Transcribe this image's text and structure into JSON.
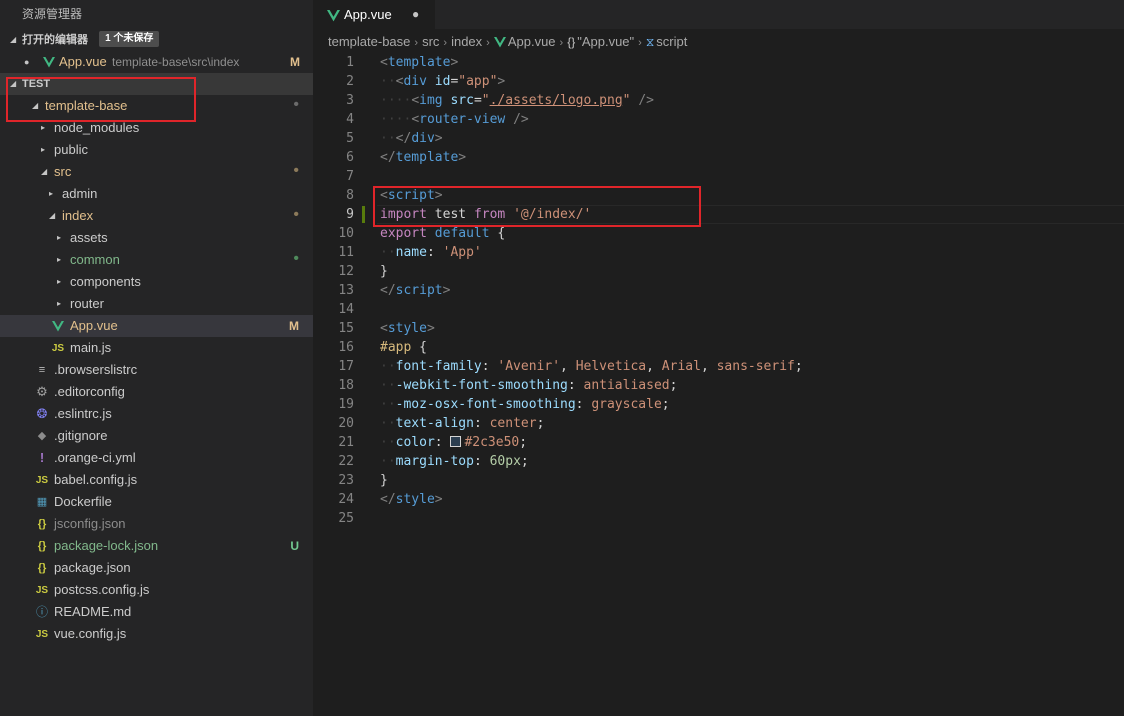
{
  "sidebar": {
    "title": "资源管理器",
    "open_editors": {
      "header": "打开的编辑器",
      "badge": "1 个未保存",
      "items": [
        {
          "name": "App.vue",
          "description": "template-base\\src\\index",
          "status": "M"
        }
      ]
    },
    "workspace": {
      "header": "TEST",
      "root": "template-base"
    },
    "tree": [
      {
        "name": "template-base",
        "kind": "folder",
        "expanded": true,
        "depth": 0,
        "status": "dot"
      },
      {
        "name": "node_modules",
        "kind": "folder",
        "expanded": false,
        "depth": 1,
        "status": ""
      },
      {
        "name": "public",
        "kind": "folder",
        "expanded": false,
        "depth": 1,
        "status": ""
      },
      {
        "name": "src",
        "kind": "folder",
        "expanded": true,
        "depth": 1,
        "status": "dot"
      },
      {
        "name": "admin",
        "kind": "folder",
        "expanded": false,
        "depth": 2,
        "status": ""
      },
      {
        "name": "index",
        "kind": "folder",
        "expanded": true,
        "depth": 2,
        "status": "dot"
      },
      {
        "name": "assets",
        "kind": "folder",
        "expanded": false,
        "depth": 3,
        "status": ""
      },
      {
        "name": "common",
        "kind": "folder",
        "expanded": false,
        "depth": 3,
        "status": "dot-green"
      },
      {
        "name": "components",
        "kind": "folder",
        "expanded": false,
        "depth": 3,
        "status": ""
      },
      {
        "name": "router",
        "kind": "folder",
        "expanded": false,
        "depth": 3,
        "status": ""
      },
      {
        "name": "App.vue",
        "kind": "vue",
        "depth": 3,
        "status": "M",
        "selected": true
      },
      {
        "name": "main.js",
        "kind": "js",
        "depth": 3,
        "status": ""
      },
      {
        "name": ".browserslistrc",
        "kind": "lines",
        "depth": 1,
        "status": ""
      },
      {
        "name": ".editorconfig",
        "kind": "gear",
        "depth": 1,
        "status": ""
      },
      {
        "name": ".eslintrc.js",
        "kind": "eslint",
        "depth": 1,
        "status": ""
      },
      {
        "name": ".gitignore",
        "kind": "git",
        "depth": 1,
        "status": ""
      },
      {
        "name": ".orange-ci.yml",
        "kind": "yml",
        "depth": 1,
        "status": ""
      },
      {
        "name": "babel.config.js",
        "kind": "js",
        "depth": 1,
        "status": ""
      },
      {
        "name": "Dockerfile",
        "kind": "docker",
        "depth": 1,
        "status": ""
      },
      {
        "name": "jsconfig.json",
        "kind": "json",
        "depth": 1,
        "status": "",
        "dim": true
      },
      {
        "name": "package-lock.json",
        "kind": "json",
        "depth": 1,
        "status": "U"
      },
      {
        "name": "package.json",
        "kind": "json",
        "depth": 1,
        "status": ""
      },
      {
        "name": "postcss.config.js",
        "kind": "js",
        "depth": 1,
        "status": ""
      },
      {
        "name": "README.md",
        "kind": "info",
        "depth": 1,
        "status": ""
      },
      {
        "name": "vue.config.js",
        "kind": "js",
        "depth": 1,
        "status": ""
      }
    ]
  },
  "tab": {
    "label": "App.vue",
    "dirty": "●"
  },
  "breadcrumb": [
    "template-base",
    "src",
    "index",
    "App.vue",
    "\"App.vue\"",
    "script"
  ],
  "editor": {
    "current_line": 9,
    "lines": [
      [
        [
          "tk-punc",
          "<"
        ],
        [
          "tk-tag",
          "template"
        ],
        [
          "tk-punc",
          ">"
        ]
      ],
      [
        [
          "ind",
          "··"
        ],
        [
          "tk-punc",
          "<"
        ],
        [
          "tk-tag",
          "div"
        ],
        [
          "tk-def",
          " "
        ],
        [
          "tk-attr",
          "id"
        ],
        [
          "tk-def",
          "="
        ],
        [
          "tk-str",
          "\"app\""
        ],
        [
          "tk-punc",
          ">"
        ]
      ],
      [
        [
          "ind",
          "····"
        ],
        [
          "tk-punc",
          "<"
        ],
        [
          "tk-tag",
          "img"
        ],
        [
          "tk-def",
          " "
        ],
        [
          "tk-attr",
          "src"
        ],
        [
          "tk-def",
          "="
        ],
        [
          "tk-str",
          "\""
        ],
        [
          "tk-link",
          "./assets/logo.png"
        ],
        [
          "tk-str",
          "\""
        ],
        [
          "tk-def",
          " "
        ],
        [
          "tk-punc",
          "/>"
        ]
      ],
      [
        [
          "ind",
          "····"
        ],
        [
          "tk-punc",
          "<"
        ],
        [
          "tk-tag",
          "router-view"
        ],
        [
          "tk-def",
          " "
        ],
        [
          "tk-punc",
          "/>"
        ]
      ],
      [
        [
          "ind",
          "··"
        ],
        [
          "tk-punc",
          "</"
        ],
        [
          "tk-tag",
          "div"
        ],
        [
          "tk-punc",
          ">"
        ]
      ],
      [
        [
          "tk-punc",
          "</"
        ],
        [
          "tk-tag",
          "template"
        ],
        [
          "tk-punc",
          ">"
        ]
      ],
      [],
      [
        [
          "tk-punc",
          "<"
        ],
        [
          "tk-tag",
          "script"
        ],
        [
          "tk-punc",
          ">"
        ]
      ],
      [
        [
          "tk-kw",
          "import"
        ],
        [
          "tk-def",
          " test "
        ],
        [
          "tk-kw",
          "from"
        ],
        [
          "tk-def",
          " "
        ],
        [
          "tk-str",
          "'@/index/'"
        ]
      ],
      [
        [
          "tk-kw",
          "export"
        ],
        [
          "tk-def",
          " "
        ],
        [
          "tk-kw2",
          "default"
        ],
        [
          "tk-def",
          " {"
        ]
      ],
      [
        [
          "ind",
          "··"
        ],
        [
          "tk-prop",
          "name"
        ],
        [
          "tk-def",
          ": "
        ],
        [
          "tk-str",
          "'App'"
        ]
      ],
      [
        [
          "tk-def",
          "}"
        ]
      ],
      [
        [
          "tk-punc",
          "</"
        ],
        [
          "tk-tag",
          "script"
        ],
        [
          "tk-punc",
          ">"
        ]
      ],
      [],
      [
        [
          "tk-punc",
          "<"
        ],
        [
          "tk-tag",
          "style"
        ],
        [
          "tk-punc",
          ">"
        ]
      ],
      [
        [
          "tk-sel",
          "#app"
        ],
        [
          "tk-def",
          " {"
        ]
      ],
      [
        [
          "ind",
          "··"
        ],
        [
          "tk-prop",
          "font-family"
        ],
        [
          "tk-def",
          ": "
        ],
        [
          "tk-val",
          "'Avenir'"
        ],
        [
          "tk-def",
          ", "
        ],
        [
          "tk-val",
          "Helvetica"
        ],
        [
          "tk-def",
          ", "
        ],
        [
          "tk-val",
          "Arial"
        ],
        [
          "tk-def",
          ", "
        ],
        [
          "tk-val",
          "sans-serif"
        ],
        [
          "tk-def",
          ";"
        ]
      ],
      [
        [
          "ind",
          "··"
        ],
        [
          "tk-prop",
          "-webkit-font-smoothing"
        ],
        [
          "tk-def",
          ": "
        ],
        [
          "tk-val",
          "antialiased"
        ],
        [
          "tk-def",
          ";"
        ]
      ],
      [
        [
          "ind",
          "··"
        ],
        [
          "tk-prop",
          "-moz-osx-font-smoothing"
        ],
        [
          "tk-def",
          ": "
        ],
        [
          "tk-val",
          "grayscale"
        ],
        [
          "tk-def",
          ";"
        ]
      ],
      [
        [
          "ind",
          "··"
        ],
        [
          "tk-prop",
          "text-align"
        ],
        [
          "tk-def",
          ": "
        ],
        [
          "tk-val",
          "center"
        ],
        [
          "tk-def",
          ";"
        ]
      ],
      [
        [
          "ind",
          "··"
        ],
        [
          "tk-prop",
          "color"
        ],
        [
          "tk-def",
          ": "
        ],
        [
          "swatch",
          "#2c3e50"
        ],
        [
          "tk-val",
          "#2c3e50"
        ],
        [
          "tk-def",
          ";"
        ]
      ],
      [
        [
          "ind",
          "··"
        ],
        [
          "tk-prop",
          "margin-top"
        ],
        [
          "tk-def",
          ": "
        ],
        [
          "tk-num",
          "60px"
        ],
        [
          "tk-def",
          ";"
        ]
      ],
      [
        [
          "tk-def",
          "}"
        ]
      ],
      [
        [
          "tk-punc",
          "</"
        ],
        [
          "tk-tag",
          "style"
        ],
        [
          "tk-punc",
          ">"
        ]
      ],
      []
    ]
  }
}
